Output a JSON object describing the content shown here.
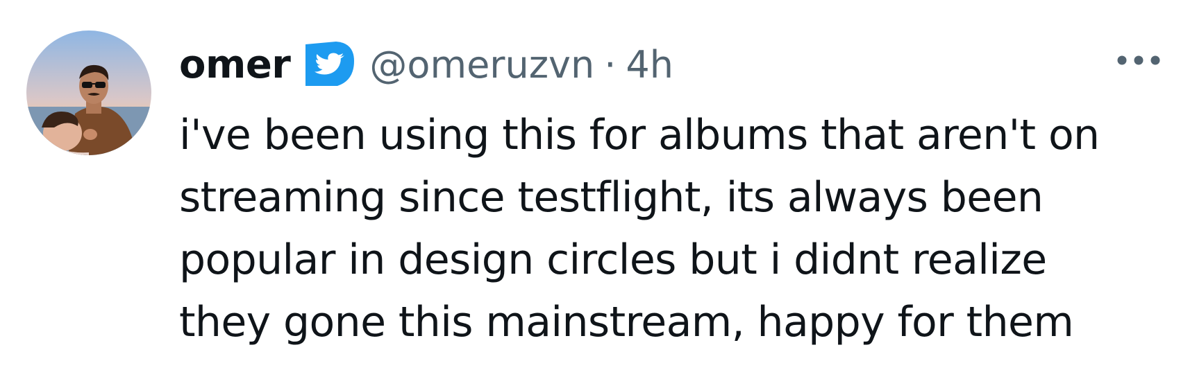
{
  "tweet": {
    "author": {
      "name": "omer",
      "handle": "@omeruzvn",
      "verified_badge_icon": "twitter-bird-verified-icon",
      "badge_color": "#1d9bf0"
    },
    "separator": "·",
    "time": "4h",
    "more_icon": "more-horizontal-icon",
    "text": "i've been using this for albums that aren't on\nstreaming since testflight, its always been\npopular in design circles but i didnt realize\nthey gone this mainstream, happy for them"
  }
}
